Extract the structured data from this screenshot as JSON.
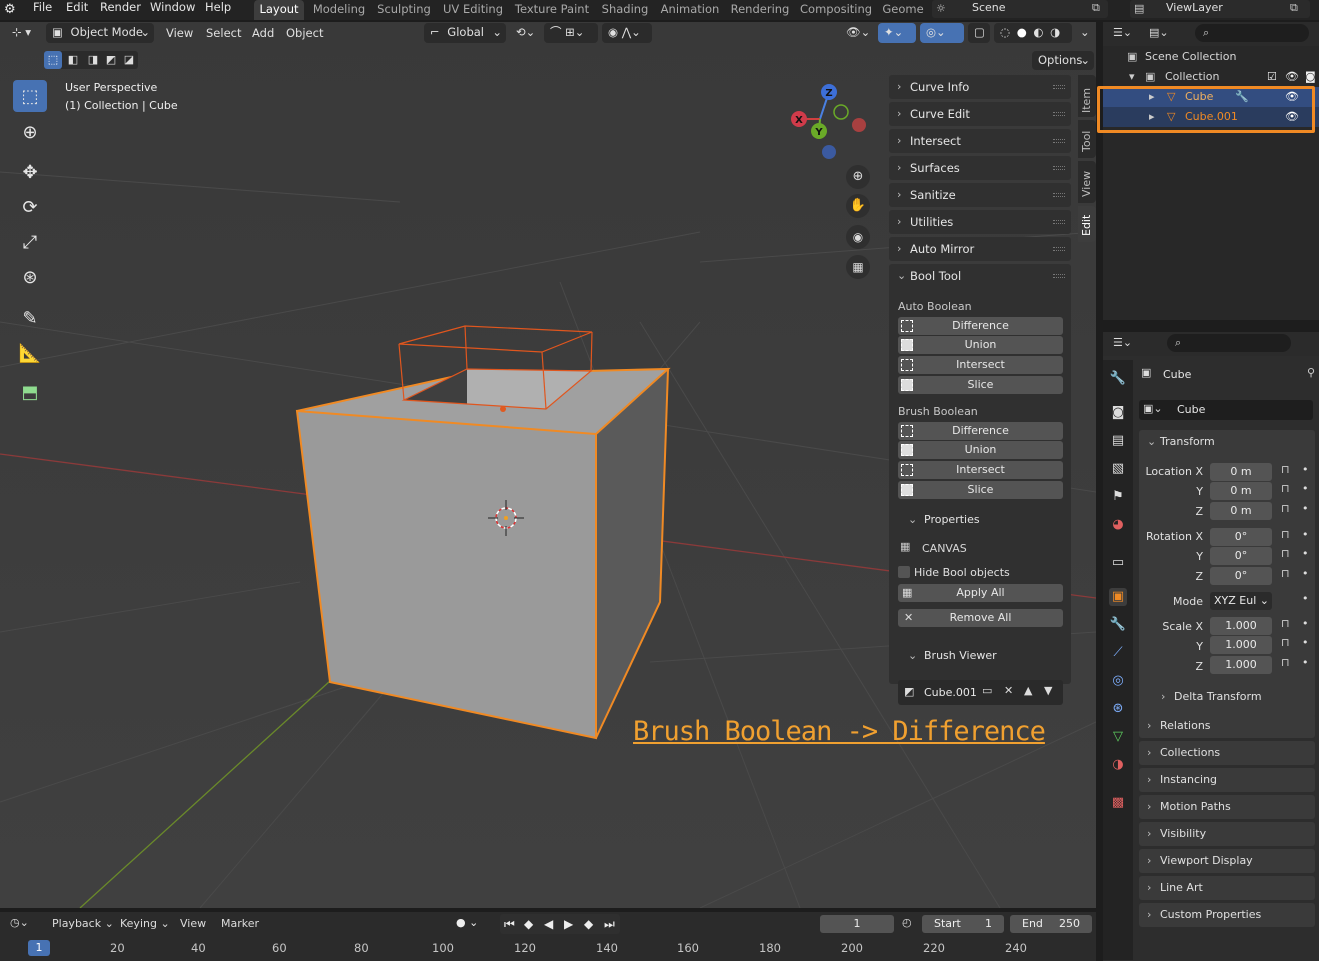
{
  "topbar": {
    "menus": [
      "File",
      "Edit",
      "Render",
      "Window",
      "Help"
    ],
    "workspaces": [
      "Layout",
      "Modeling",
      "Sculpting",
      "UV Editing",
      "Texture Paint",
      "Shading",
      "Animation",
      "Rendering",
      "Compositing",
      "Geome"
    ],
    "active_workspace": "Layout",
    "scene": "Scene",
    "view_layer": "ViewLayer"
  },
  "viewport_header": {
    "mode": "Object Mode",
    "menus": [
      "View",
      "Select",
      "Add",
      "Object"
    ],
    "transform_orientation": "Global",
    "options": "Options"
  },
  "viewport": {
    "perspective": "User Perspective",
    "context": "(1) Collection | Cube",
    "gizmo_axes": [
      "Z",
      "Y",
      "X"
    ]
  },
  "side_tabs": [
    "Item",
    "Tool",
    "View",
    "Edit"
  ],
  "npanel": {
    "sections": [
      "Curve Info",
      "Curve Edit",
      "Intersect",
      "Surfaces",
      "Sanitize",
      "Utilities",
      "Auto Mirror",
      "Bool Tool"
    ],
    "auto_boolean_label": "Auto Boolean",
    "auto_boolean": [
      "Difference",
      "Union",
      "Intersect",
      "Slice"
    ],
    "brush_boolean_label": "Brush Boolean",
    "brush_boolean": [
      "Difference",
      "Union",
      "Intersect",
      "Slice"
    ],
    "properties_label": "Properties",
    "canvas_label": "CANVAS",
    "hide_bool": "Hide Bool objects",
    "apply_all": "Apply All",
    "remove_all": "Remove All",
    "brush_viewer_label": "Brush Viewer",
    "brush_viewer_object": "Cube.001"
  },
  "annotation": "Brush Boolean -> Difference",
  "outliner": {
    "scene_collection": "Scene Collection",
    "collection": "Collection",
    "objects": [
      "Cube",
      "Cube.001"
    ]
  },
  "properties": {
    "object_name": "Cube",
    "data_name": "Cube",
    "transform_label": "Transform",
    "location_labels": [
      "Location X",
      "Y",
      "Z"
    ],
    "location_values": [
      "0 m",
      "0 m",
      "0 m"
    ],
    "rotation_labels": [
      "Rotation X",
      "Y",
      "Z"
    ],
    "rotation_values": [
      "0°",
      "0°",
      "0°"
    ],
    "mode_label": "Mode",
    "mode_value": "XYZ Eul",
    "scale_labels": [
      "Scale X",
      "Y",
      "Z"
    ],
    "scale_values": [
      "1.000",
      "1.000",
      "1.000"
    ],
    "delta_transform": "Delta Transform",
    "sections": [
      "Relations",
      "Collections",
      "Instancing",
      "Motion Paths",
      "Visibility",
      "Viewport Display",
      "Line Art",
      "Custom Properties"
    ]
  },
  "timeline": {
    "menus": [
      "Playback",
      "Keying",
      "View",
      "Marker"
    ],
    "current_frame": "1",
    "start_label": "Start",
    "start": "1",
    "end_label": "End",
    "end": "250",
    "ruler": [
      "1",
      "20",
      "40",
      "60",
      "80",
      "100",
      "120",
      "140",
      "160",
      "180",
      "200",
      "220",
      "240"
    ]
  },
  "colors": {
    "accent_blue": "#4772b3",
    "selection_orange": "#f08a24",
    "annotation_orange": "#f0a030"
  }
}
